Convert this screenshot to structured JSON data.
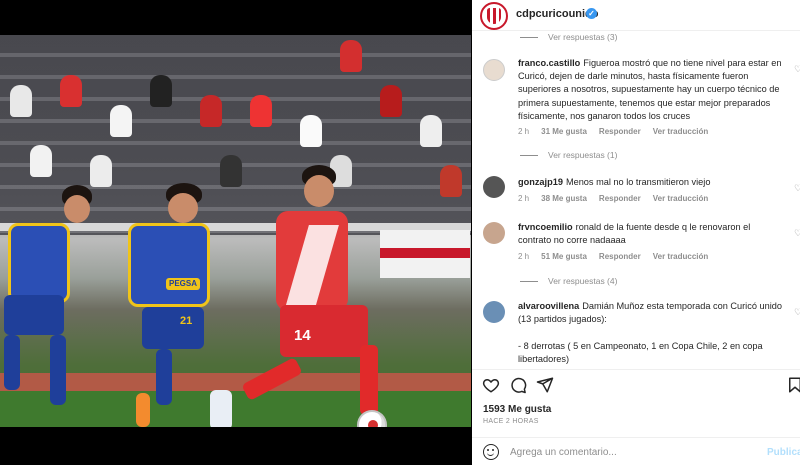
{
  "header": {
    "username": "cdpcuricounido",
    "verified_icon": "verified-badge-icon"
  },
  "comments": {
    "top_replies": "Ver respuestas (3)",
    "items": [
      {
        "username": "franco.castillo",
        "text": "Figueroa mostró que no tiene nivel para estar en Curicó, dejen de darle minutos, hasta físicamente fueron superiores a nosotros, supuestamente hay un cuerpo técnico de primera supuestamente, tenemos que estar mejor preparados físicamente, nos ganaron todos los cruces",
        "time": "2 h",
        "likes": "31 Me gusta",
        "reply": "Responder",
        "translate": "Ver traducción",
        "replies": "Ver respuestas (1)"
      },
      {
        "username": "gonzajp19",
        "text": "Menos mal no lo transmitieron viejo",
        "time": "2 h",
        "likes": "38 Me gusta",
        "reply": "Responder",
        "translate": "Ver traducción",
        "replies": ""
      },
      {
        "username": "frvncoemilio",
        "text": "ronald de la fuente desde q le renovaron el contrato no corre nadaaaa",
        "time": "2 h",
        "likes": "51 Me gusta",
        "reply": "Responder",
        "translate": "Ver traducción",
        "replies": "Ver respuestas (4)"
      },
      {
        "username": "alvaroovillena",
        "text": "Damián Muñoz esta temporada con Curicó unido (13 partidos jugados):",
        "text2": "- 8 derrotas ( 5 en Campeonato, 1 en Copa Chile, 2 en copa libertadores)"
      }
    ]
  },
  "post": {
    "likes": "1593 Me gusta",
    "time": "HACE 2 HORAS",
    "comment_placeholder": "Agrega un comentario...",
    "post_label": "Publicar"
  },
  "photo": {
    "sponsor": "PEGSA",
    "number_red": "14",
    "number_blue": "21"
  },
  "colors": {
    "accent_link": "#3897f0",
    "post_disabled": "#b2dffc",
    "club_red": "#c8182b",
    "rival_yellow": "#f0c419",
    "rival_blue": "#2b4fb5"
  }
}
